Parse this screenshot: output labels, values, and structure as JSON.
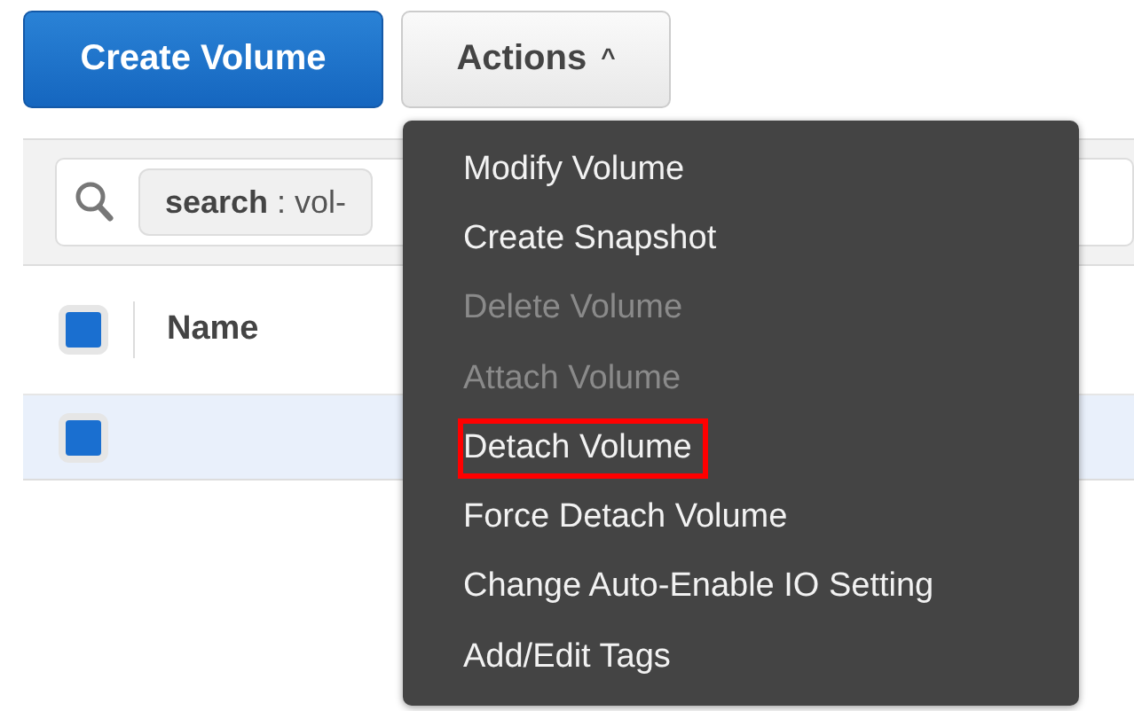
{
  "toolbar": {
    "create_button": "Create Volume",
    "actions_button": {
      "label": "Actions",
      "caret": "^",
      "expanded": true
    }
  },
  "search": {
    "token_key": "search",
    "token_value": " : vol-"
  },
  "table": {
    "header_checkbox": {
      "checked": true
    },
    "columns": [
      "Name"
    ],
    "rows": [
      {
        "checked": true,
        "selected": true
      }
    ]
  },
  "menu": [
    {
      "label": "Modify Volume",
      "disabled": false,
      "highlighted": false
    },
    {
      "label": "Create Snapshot",
      "disabled": false,
      "highlighted": false
    },
    {
      "label": "Delete Volume",
      "disabled": true,
      "highlighted": false
    },
    {
      "label": "Attach Volume",
      "disabled": true,
      "highlighted": false
    },
    {
      "label": "Detach Volume",
      "disabled": false,
      "highlighted": true
    },
    {
      "label": "Force Detach Volume",
      "disabled": false,
      "highlighted": false
    },
    {
      "label": "Change Auto-Enable IO Setting",
      "disabled": false,
      "highlighted": false
    },
    {
      "label": "Add/Edit Tags",
      "disabled": false,
      "highlighted": false
    }
  ]
}
